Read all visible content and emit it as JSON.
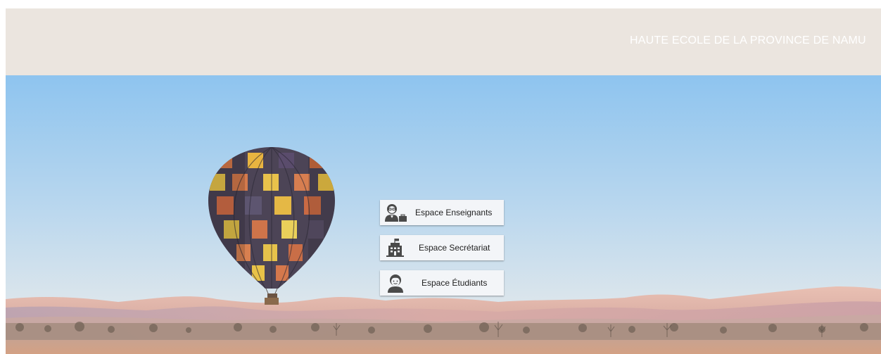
{
  "header": {
    "title": "HAUTE ECOLE DE LA PROVINCE DE NAMU"
  },
  "menu": {
    "items": [
      {
        "label": "Espace Enseignants",
        "icon": "teacher-icon"
      },
      {
        "label": "Espace Secrétariat",
        "icon": "building-icon"
      },
      {
        "label": "Espace Étudiants",
        "icon": "student-icon"
      }
    ]
  },
  "colors": {
    "header_bg": "#ebe5df",
    "button_bg": "#f3f5f8",
    "sky_top": "#8ec4ef",
    "sky_bottom": "#dde8ee",
    "dunes": "#e7b8ad"
  }
}
